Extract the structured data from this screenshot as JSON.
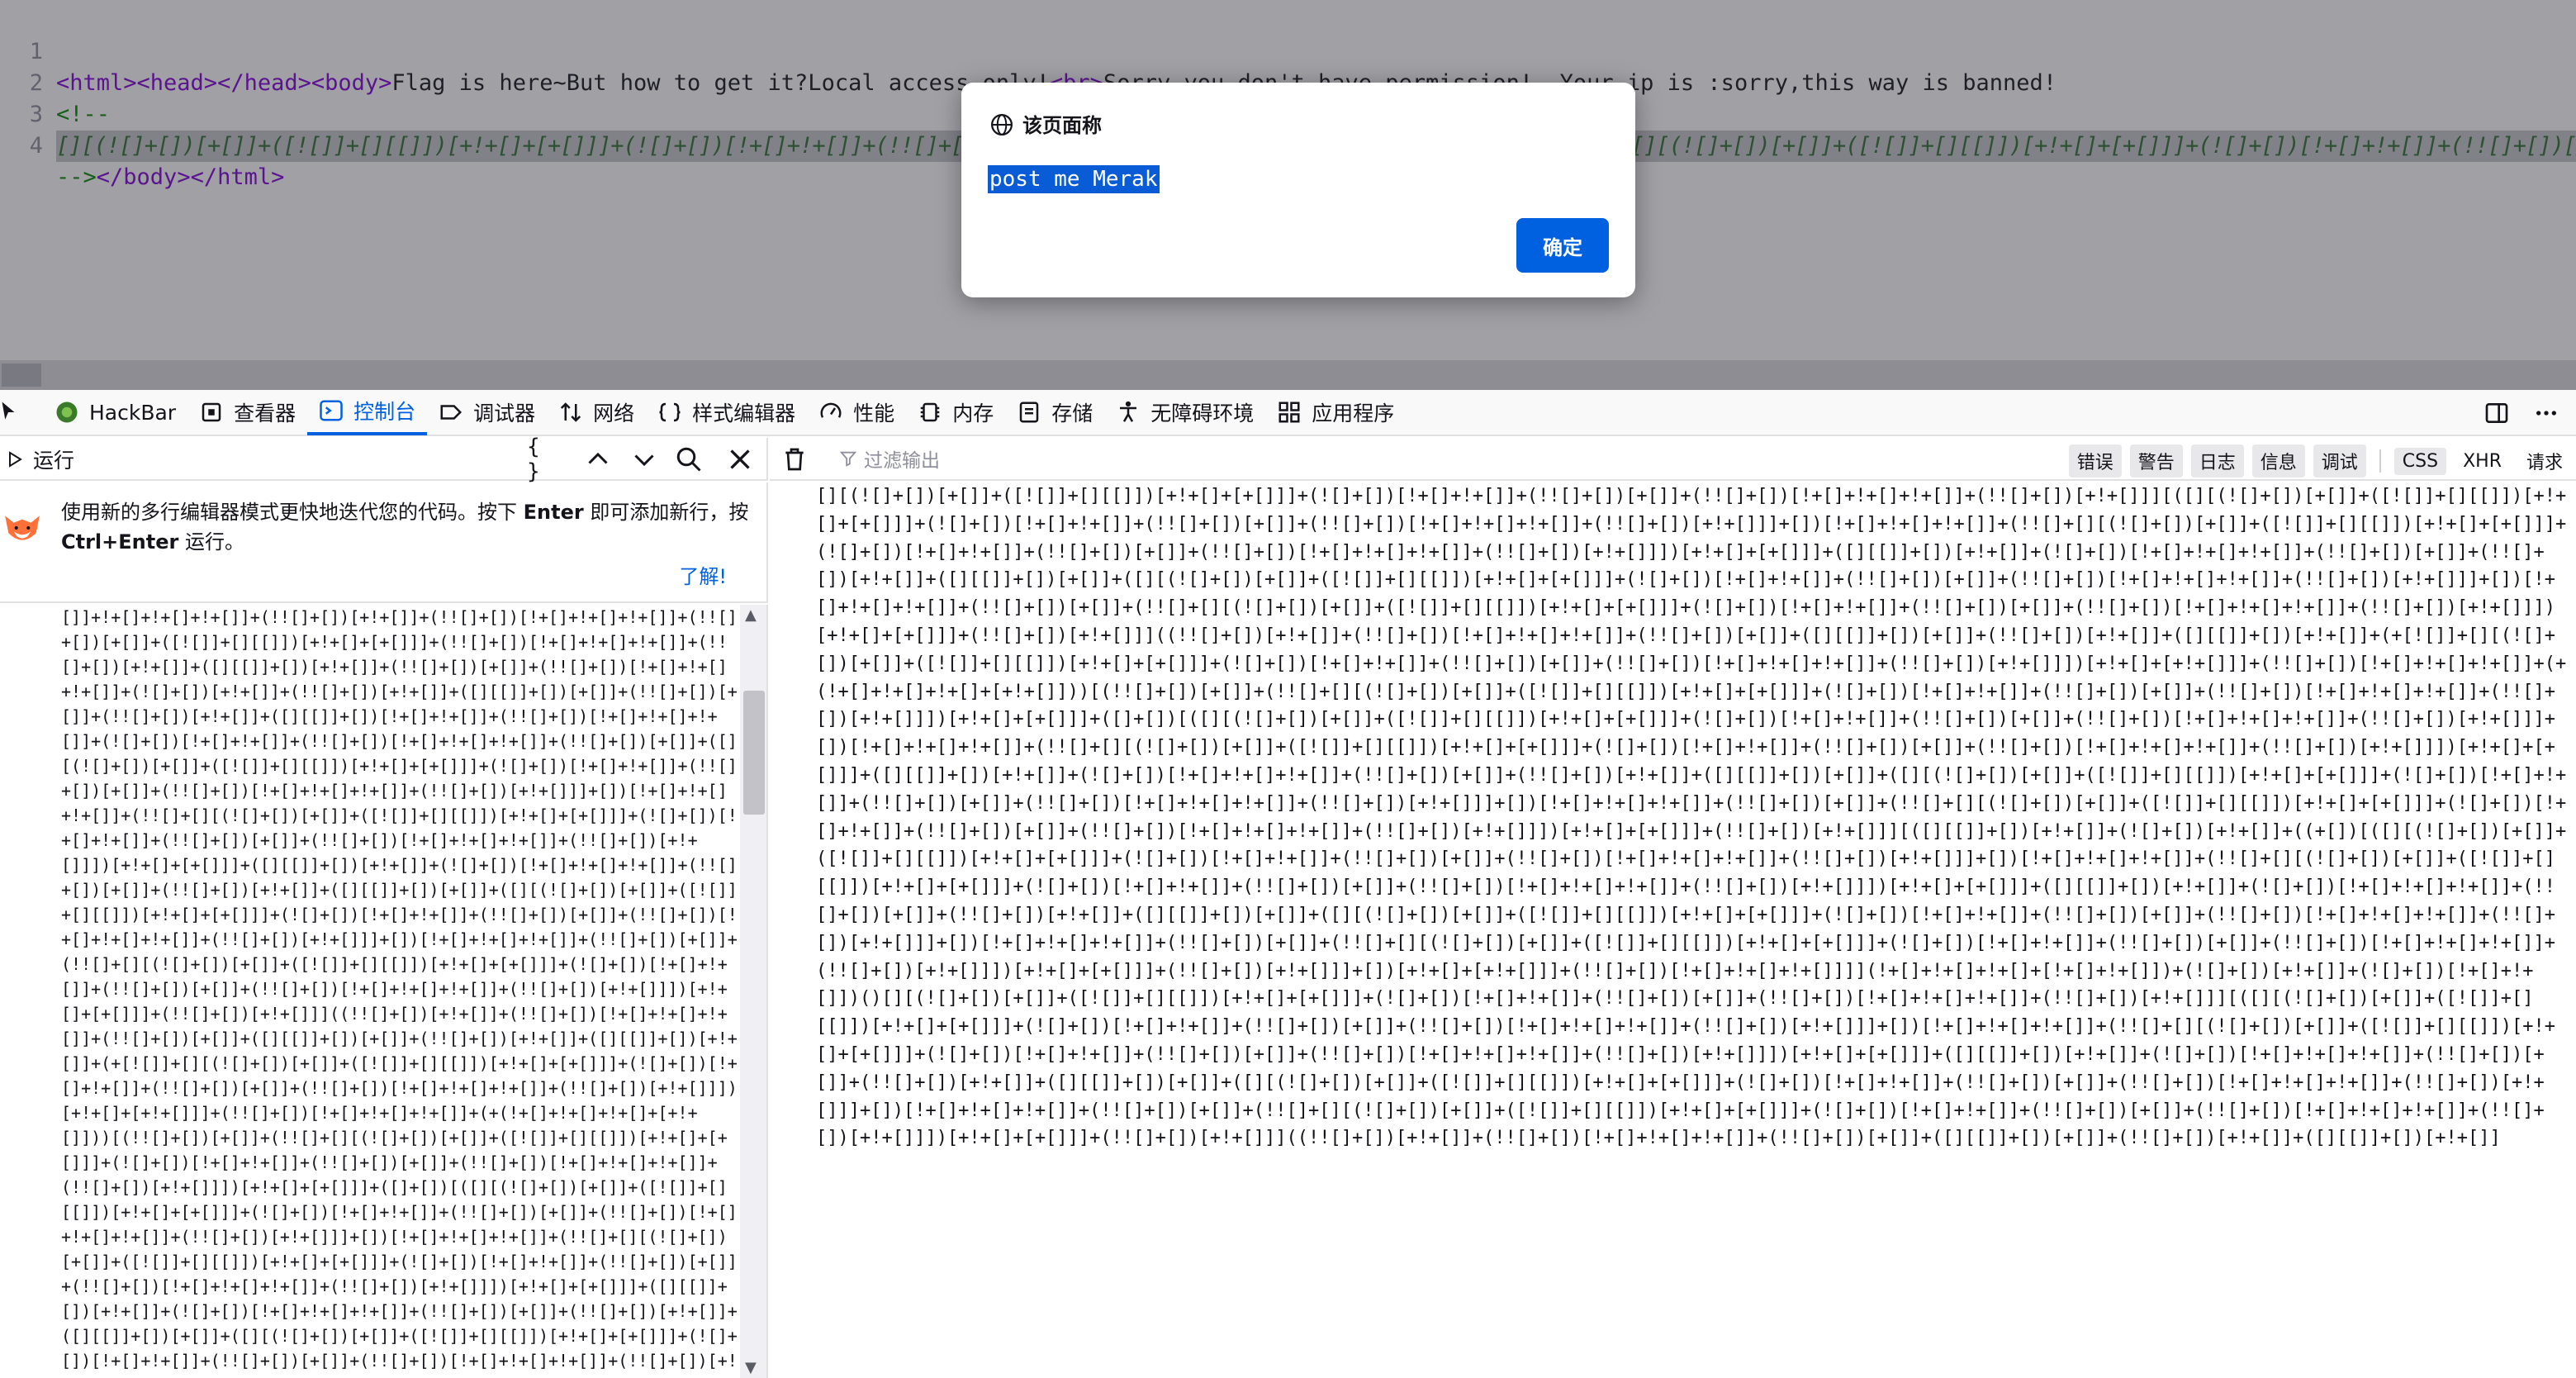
{
  "source": {
    "lines": [
      {
        "num": "1",
        "open_tags": "<html><head></head><body>",
        "text": "Flag is here~But how to get it?Local access only!",
        "br": "<br>",
        "text2": "Sorry,you don't have permission!  Your ip is :sorry,this way is banned!"
      },
      {
        "num": "2",
        "comment_open": "<!--"
      },
      {
        "num": "3",
        "code": "[][(![]+[])[+[]]+([![]]+[][[]])[+!+[]+[+[]]]+(![]+[])[!+[]+!+[]]+(!![]+[])[+[]]+(!![]+[])[!+[]+!+[]+!+[]]+(!![]+[])[+!+[]]][([][(![]+[])[+[]]+([![]]+[][[]])[+!+[]+[+[]]]+(![]+[])[!+[]+!+[]]+(!![]+[])[+[]]+(!![]+[])[!+[]+!+[]+!+[]]+(!![]+[])[+!+[]]]+[])[!+[]+!+[]+!+[]]+(!![]+[][(![]+[])[+[]]+([![]]+[][[]])[+!+[]+[+[]]]+(![]+[])[!+[]+!+[]]+(!![]+[])[+[]]+(!![]+[])[!+[]+!+[]+!+[]]"
      },
      {
        "num": "4",
        "comment_close": "-->",
        "close_tags": "</body></html>"
      }
    ]
  },
  "dialog": {
    "title": "该页面称",
    "message": "post me Merak",
    "ok_label": "确定"
  },
  "devtools": {
    "tabs": [
      {
        "label": "HackBar",
        "icon": "hackbar-icon"
      },
      {
        "label": "查看器",
        "icon": "inspector-icon"
      },
      {
        "label": "控制台",
        "icon": "console-icon",
        "active": true
      },
      {
        "label": "调试器",
        "icon": "debugger-icon"
      },
      {
        "label": "网络",
        "icon": "network-icon"
      },
      {
        "label": "样式编辑器",
        "icon": "style-editor-icon"
      },
      {
        "label": "性能",
        "icon": "performance-icon"
      },
      {
        "label": "内存",
        "icon": "memory-icon"
      },
      {
        "label": "存储",
        "icon": "storage-icon"
      },
      {
        "label": "无障碍环境",
        "icon": "accessibility-icon"
      },
      {
        "label": "应用程序",
        "icon": "application-icon"
      }
    ]
  },
  "editor": {
    "run_label": "运行",
    "pretty_print": "{ }",
    "notice_pre": "使用新的多行编辑器模式更快地迭代您的代码。按下 ",
    "notice_key1": "Enter",
    "notice_mid": " 即可添加新行，按 ",
    "notice_key2": "Ctrl+Enter",
    "notice_post": " 运行。",
    "notice_link": "了解!",
    "content": "[]]+!+[]+!+[]+!+[]]+(!![]+[])[+!+[]]+(!![]+[])[!+[]+!+[]+!+[]]+(!![]+[])[+[]]+([![]]+[][[]])[+!+[]+[+[]]]+(!![]+[])[!+[]+!+[]+!+[]]+(!![]+[])[+!+[]]+([][[]]+[])[+!+[]]+(!![]+[])[+[]]+(!![]+[])[!+[]+!+[]+!+[]]+(![]+[])[+!+[]]+(!![]+[])[+!+[]]+([][[]]+[])[+[]]+(!![]+[])[+[]]+(!![]+[])[+!+[]]+([][[]]+[])[!+[]+!+[]]+(!![]+[])[!+[]+!+[]+!+[]]+(![]+[])[!+[]+!+[]]+(!![]+[])[!+[]+!+[]+!+[]]+(!![]+[])[+[]]+([][(![]+[])[+[]]+([![]]+[][[]])[+!+[]+[+[]]]+(![]+[])[!+[]+!+[]]+(!![]+[])[+[]]+(!![]+[])[!+[]+!+[]+!+[]]+(!![]+[])[+!+[]]]+[])[!+[]+!+[]+!+[]]+(!![]+[][(![]+[])[+[]]+([![]]+[][[]])[+!+[]+[+[]]]+(![]+[])[!+[]+!+[]]+(!![]+[])[+[]]+(!![]+[])[!+[]+!+[]+!+[]]+(!![]+[])[+!+[]]])[+!+[]+[+[]]]+([][[]]+[])[+!+[]]+(![]+[])[!+[]+!+[]+!+[]]+(!![]+[])[+[]]+(!![]+[])[+!+[]]+([][[]]+[])[+[]]+([][(![]+[])[+[]]+([![]]+[][[]])[+!+[]+[+[]]]+(![]+[])[!+[]+!+[]]+(!![]+[])[+[]]+(!![]+[])[!+[]+!+[]+!+[]]+(!![]+[])[+!+[]]]+[])[!+[]+!+[]+!+[]]+(!![]+[])[+[]]+(!![]+[][(![]+[])[+[]]+([![]]+[][[]])[+!+[]+[+[]]]+(![]+[])[!+[]+!+[]]+(!![]+[])[+[]]+(!![]+[])[!+[]+!+[]+!+[]]+(!![]+[])[+!+[]]])[+!+[]+[+[]]]+(!![]+[])[+!+[]]]((!![]+[])[+!+[]]+(!![]+[])[!+[]+!+[]+!+[]]+(!![]+[])[+[]]+([][[]]+[])[+[]]+(!![]+[])[+!+[]]+([][[]]+[])[+!+[]]+(+[![]]+[][(![]+[])[+[]]+([![]]+[][[]])[+!+[]+[+[]]]+(![]+[])[!+[]+!+[]]+(!![]+[])[+[]]+(!![]+[])[!+[]+!+[]+!+[]]+(!![]+[])[+!+[]]])[+!+[]+[+!+[]]]+(!![]+[])[!+[]+!+[]+!+[]]+(+(!+[]+!+[]+!+[]+[+!+[]]))[(!![]+[])[+[]]+(!![]+[][(![]+[])[+[]]+([![]]+[][[]])[+!+[]+[+[]]]+(![]+[])[!+[]+!+[]]+(!![]+[])[+[]]+(!![]+[])[!+[]+!+[]+!+[]]+(!![]+[])[+!+[]]])[+!+[]+[+[]]]+([]+[])[([][(![]+[])[+[]]+([![]]+[][[]])[+!+[]+[+[]]]+(![]+[])[!+[]+!+[]]+(!![]+[])[+[]]+(!![]+[])[!+[]+!+[]+!+[]]+(!![]+[])[+!+[]]]+[])[!+[]+!+[]+!+[]]+(!![]+[][(![]+[])[+[]]+([![]]+[][[]])[+!+[]+[+[]]]+(![]+[])[!+[]+!+[]]+(!![]+[])[+[]]+(!![]+[])[!+[]+!+[]+!+[]]+(!![]+[])[+!+[]]])[+!+[]+[+[]]]+([][[]]+[])[+!+[]]+(![]+[])[!+[]+!+[]+!+[]]+(!![]+[])[+[]]+(!![]+[])[+!+[]]+([][[]]+[])[+[]]+([][(![]+[])[+[]]+([![]]+[][[]])[+!+[]+[+[]]]+(![]+[])[!+[]+!+[]]+(!![]+[])[+[]]+(!![]+[])[!+[]+!+[]+!+[]]+(!![]+[])[+!+[]]]+[])[!+[]+!+[]+!+[]]+(!![]+[])[+[]]+(!![]+[][(![]+[])[+[]]+([![]]+[][[]])[+!+[]+[+[]]]+(![]+[])[!+[]+!+[]]+(!![]+[])[+[]]+(!![]+[])[!+[]+!+[]+!+[]]+(!![]+[])[+!+[]]])[+!+[]+[+[]]]+(!![]+[])[+!+[]]][([][[]]+[])[+!+[]]+(![]+[])[+!+[]]+((+[])[([][(![]+[])[+[]]+([![]]+[][[]])[+!+[]+[+[]]]+(![]+[])[!+[]+!+[]]+(!![]+[])[+[]]+(!![]+[])[!+[]+!+[]+!+[]]+(!![]+[])[+!+[]]]+[])[!+[]+!+[]+!+[]]+(!![]+[][(![]+[])[+[]]+([![]]+[][[]])[+!+[]+[+[]]]+(![]+[])[!+[]+!+[]]+(!![]+[])[+[]]+(!![]+[])[!+[]+!+[]+!+[]]+(!![]+[])[+!+[]]])[+!+[]+[+[]]]+([][[]]+[])[+!+[]]+(![]+[])[!+[]+!+[]+!+[]]+(!![]+[])[+[]]+(!![]+[])[+!+[]]+([][[]]+[])[+[]]+([][(![]+[])[+[]]+([![]]+[][[]])[+!+[]+[+[]]]+(![]+[])[!+[]+!+[]]+(!![]+[])[+[]]+(!![]+[])[!+[]+!+[]+!+[]]+(!![]+[])[+!+[]]]+[])[!+[]+!+[]+!+[]]+(!![]+[])[+[]]+(!![]+[][(![]+[])[+[]]+([![]]+[][[]])[+!+[]+[+[]]]+(![]+[])[!+[]+!+[]]+(!![]+[])[+[]]+(!![]+[])[!+[]+!+[]+!+[]]+(!![]+[])[+!+[]]])[+!+[]+[+[]]]+(!![]+[])[+!+[]]]+[])[+!+[]+[+!+[]]]+(!![]+[])[!+[]+!+[]+!+[]]]](!+[]+!+[]+!+[]+[!+[]+!+[]])+(![]+[])[+!+[]]+(![]+[])[!+[]+!+[]])()"
  },
  "console": {
    "filter_placeholder": "过滤输出",
    "filters": [
      "错误",
      "警告",
      "日志",
      "信息",
      "调试"
    ],
    "extra_filters": [
      "CSS",
      "XHR",
      "请求"
    ],
    "output": "[][(![]+[])[+[]]+([![]]+[][[]])[+!+[]+[+[]]]+(![]+[])[!+[]+!+[]]+(!![]+[])[+[]]+(!![]+[])[!+[]+!+[]+!+[]]+(!![]+[])[+!+[]]][([][(![]+[])[+[]]+([![]]+[][[]])[+!+[]+[+[]]]+(![]+[])[!+[]+!+[]]+(!![]+[])[+[]]+(!![]+[])[!+[]+!+[]+!+[]]+(!![]+[])[+!+[]]]+[])[!+[]+!+[]+!+[]]+(!![]+[][(![]+[])[+[]]+([![]]+[][[]])[+!+[]+[+[]]]+(![]+[])[!+[]+!+[]]+(!![]+[])[+[]]+(!![]+[])[!+[]+!+[]+!+[]]+(!![]+[])[+!+[]]])[+!+[]+[+[]]]+([][[]]+[])[+!+[]]+(![]+[])[!+[]+!+[]+!+[]]+(!![]+[])[+[]]+(!![]+[])[+!+[]]+([][[]]+[])[+[]]+([][(![]+[])[+[]]+([![]]+[][[]])[+!+[]+[+[]]]+(![]+[])[!+[]+!+[]]+(!![]+[])[+[]]+(!![]+[])[!+[]+!+[]+!+[]]+(!![]+[])[+!+[]]]+[])[!+[]+!+[]+!+[]]+(!![]+[])[+[]]+(!![]+[][(![]+[])[+[]]+([![]]+[][[]])[+!+[]+[+[]]]+(![]+[])[!+[]+!+[]]+(!![]+[])[+[]]+(!![]+[])[!+[]+!+[]+!+[]]+(!![]+[])[+!+[]]])[+!+[]+[+[]]]+(!![]+[])[+!+[]]]((!![]+[])[+!+[]]+(!![]+[])[!+[]+!+[]+!+[]]+(!![]+[])[+[]]+([][[]]+[])[+[]]+(!![]+[])[+!+[]]+([][[]]+[])[+!+[]]+(+[![]]+[][(![]+[])[+[]]+([![]]+[][[]])[+!+[]+[+[]]]+(![]+[])[!+[]+!+[]]+(!![]+[])[+[]]+(!![]+[])[!+[]+!+[]+!+[]]+(!![]+[])[+!+[]]])[+!+[]+[+!+[]]]+(!![]+[])[!+[]+!+[]+!+[]]+(+(!+[]+!+[]+!+[]+[+!+[]]))[(!![]+[])[+[]]+(!![]+[][(![]+[])[+[]]+([![]]+[][[]])[+!+[]+[+[]]]+(![]+[])[!+[]+!+[]]+(!![]+[])[+[]]+(!![]+[])[!+[]+!+[]+!+[]]+(!![]+[])[+!+[]]])[+!+[]+[+[]]]+([]+[])[([][(![]+[])[+[]]+([![]]+[][[]])[+!+[]+[+[]]]+(![]+[])[!+[]+!+[]]+(!![]+[])[+[]]+(!![]+[])[!+[]+!+[]+!+[]]+(!![]+[])[+!+[]]]+[])[!+[]+!+[]+!+[]]+(!![]+[][(![]+[])[+[]]+([![]]+[][[]])[+!+[]+[+[]]]+(![]+[])[!+[]+!+[]]+(!![]+[])[+[]]+(!![]+[])[!+[]+!+[]+!+[]]+(!![]+[])[+!+[]]])[+!+[]+[+[]]]+([][[]]+[])[+!+[]]+(![]+[])[!+[]+!+[]+!+[]]+(!![]+[])[+[]]+(!![]+[])[+!+[]]+([][[]]+[])[+[]]+([][(![]+[])[+[]]+([![]]+[][[]])[+!+[]+[+[]]]+(![]+[])[!+[]+!+[]]+(!![]+[])[+[]]+(!![]+[])[!+[]+!+[]+!+[]]+(!![]+[])[+!+[]]]+[])[!+[]+!+[]+!+[]]+(!![]+[])[+[]]+(!![]+[][(![]+[])[+[]]+([![]]+[][[]])[+!+[]+[+[]]]+(![]+[])[!+[]+!+[]]+(!![]+[])[+[]]+(!![]+[])[!+[]+!+[]+!+[]]+(!![]+[])[+!+[]]])[+!+[]+[+[]]]+(!![]+[])[+!+[]]][([][[]]+[])[+!+[]]+(![]+[])[+!+[]]+((+[])[([][(![]+[])[+[]]+([![]]+[][[]])[+!+[]+[+[]]]+(![]+[])[!+[]+!+[]]+(!![]+[])[+[]]+(!![]+[])[!+[]+!+[]+!+[]]+(!![]+[])[+!+[]]]+[])[!+[]+!+[]+!+[]]+(!![]+[][(![]+[])[+[]]+([![]]+[][[]])[+!+[]+[+[]]]+(![]+[])[!+[]+!+[]]+(!![]+[])[+[]]+(!![]+[])[!+[]+!+[]+!+[]]+(!![]+[])[+!+[]]])[+!+[]+[+[]]]+([][[]]+[])[+!+[]]+(![]+[])[!+[]+!+[]+!+[]]+(!![]+[])[+[]]+(!![]+[])[+!+[]]+([][[]]+[])[+[]]+([][(![]+[])[+[]]+([![]]+[][[]])[+!+[]+[+[]]]+(![]+[])[!+[]+!+[]]+(!![]+[])[+[]]+(!![]+[])[!+[]+!+[]+!+[]]+(!![]+[])[+!+[]]]+[])[!+[]+!+[]+!+[]]+(!![]+[])[+[]]+(!![]+[][(![]+[])[+[]]+([![]]+[][[]])[+!+[]+[+[]]]+(![]+[])[!+[]+!+[]]+(!![]+[])[+[]]+(!![]+[])[!+[]+!+[]+!+[]]+(!![]+[])[+!+[]]])[+!+[]+[+[]]]+(!![]+[])[+!+[]]]+[])[+!+[]+[+!+[]]]+(!![]+[])[!+[]+!+[]+!+[]]]](!+[]+!+[]+!+[]+[!+[]+!+[]])+(![]+[])[+!+[]]+(![]+[])[!+[]+!+[]])()[][(![]+[])[+[]]+([![]]+[][[]])[+!+[]+[+[]]]+(![]+[])[!+[]+!+[]]+(!![]+[])[+[]]+(!![]+[])[!+[]+!+[]+!+[]]+(!![]+[])[+!+[]]][([][(![]+[])[+[]]+([![]]+[][[]])[+!+[]+[+[]]]+(![]+[])[!+[]+!+[]]+(!![]+[])[+[]]+(!![]+[])[!+[]+!+[]+!+[]]+(!![]+[])[+!+[]]]+[])[!+[]+!+[]+!+[]]+(!![]+[][(![]+[])[+[]]+([![]]+[][[]])[+!+[]+[+[]]]+(![]+[])[!+[]+!+[]]+(!![]+[])[+[]]+(!![]+[])[!+[]+!+[]+!+[]]+(!![]+[])[+!+[]]])[+!+[]+[+[]]]+([][[]]+[])[+!+[]]+(![]+[])[!+[]+!+[]+!+[]]+(!![]+[])[+[]]+(!![]+[])[+!+[]]+([][[]]+[])[+[]]+([][(![]+[])[+[]]+([![]]+[][[]])[+!+[]+[+[]]]+(![]+[])[!+[]+!+[]]+(!![]+[])[+[]]+(!![]+[])[!+[]+!+[]+!+[]]+(!![]+[])[+!+[]]]+[])[!+[]+!+[]+!+[]]+(!![]+[])[+[]]+(!![]+[][(![]+[])[+[]]+([![]]+[][[]])[+!+[]+[+[]]]+(![]+[])[!+[]+!+[]]+(!![]+[])[+[]]+(!![]+[])[!+[]+!+[]+!+[]]+(!![]+[])[+!+[]]])[+!+[]+[+[]]]+(!![]+[])[+!+[]]]((!![]+[])[+!+[]]+(!![]+[])[!+[]+!+[]+!+[]]+(!![]+[])[+[]]+([][[]]+[])[+[]]+(!![]+[])[+!+[]]+([][[]]+[])[+!+[]]"
  }
}
